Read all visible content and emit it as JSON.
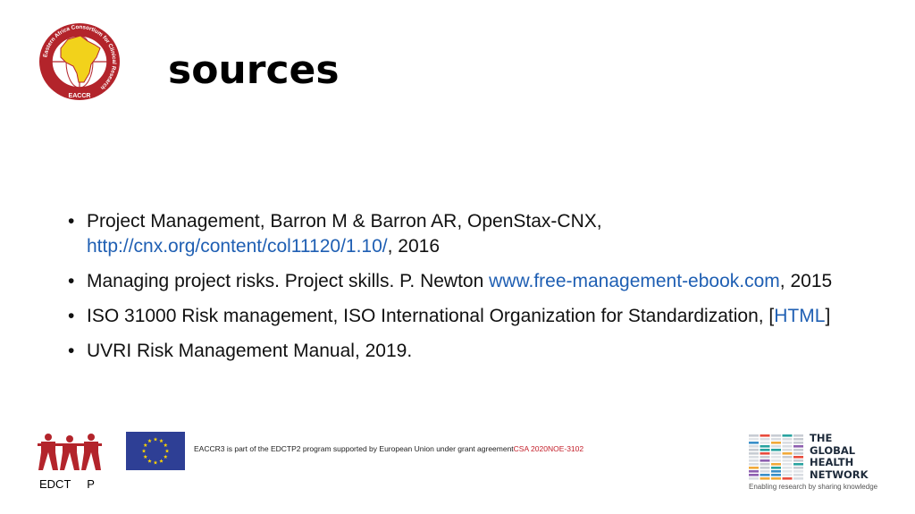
{
  "slide": {
    "title": "sources",
    "bullets": [
      {
        "marker": "•",
        "text": "Project Management, Barron M & Barron AR, OpenStax-CNX, ",
        "link": "http://cnx.org/content/col11120/1.10/",
        "after": ", 2016"
      },
      {
        "marker": "•",
        "text": "Managing project risks. Project skills. P. Newton ",
        "link": "www.free-management-ebook.com",
        "after": ", 2015"
      },
      {
        "marker": "•",
        "text": "ISO 31000 Risk management, ISO International Organization for Standardization, [",
        "link": "HTML",
        "after": "]"
      },
      {
        "marker": "•",
        "text": "UVRI Risk Management Manual, 2019.",
        "link": "",
        "after": ""
      }
    ]
  },
  "logos": {
    "eaccr": {
      "ring_text": "Eastern Africa Consortium for Clinical Research",
      "label": "EACCR",
      "colors": {
        "red": "#b3242b",
        "yellow": "#f2d21b"
      }
    },
    "edctp": {
      "label": "EDCT     P",
      "color": "#b3242b"
    },
    "eu_flag": {
      "colors": {
        "blue": "#2e3f95",
        "stars": "#ffd500"
      }
    },
    "ghn": {
      "name_lines": [
        "THE",
        "GLOBAL",
        "HEALTH",
        "NETWORK"
      ],
      "tagline": "Enabling research by sharing knowledge"
    }
  },
  "footer": {
    "grant_text": "EACCR3 is part of the EDCTP2 program supported by European Union under grant agreement",
    "grant_number": "CSA 2020NOE-3102"
  }
}
